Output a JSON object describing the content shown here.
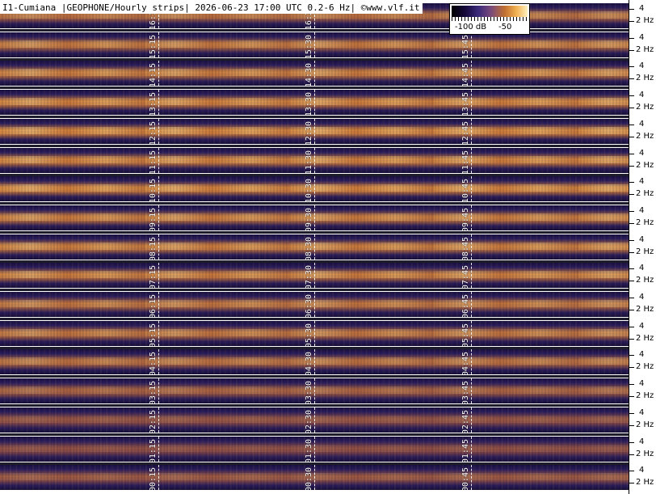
{
  "header": {
    "title": "I1-Cumiana |GEOPHONE/Hourly strips| 2026-06-23 17:00 UTC 0.2-6 Hz| ©www.vlf.it"
  },
  "colorbar": {
    "labels": [
      "-100 dB",
      "-50"
    ],
    "colors": [
      "#000000",
      "#14083a",
      "#3a2a7a",
      "#7a4a7a",
      "#c07030",
      "#f0b050",
      "#fff0c0"
    ]
  },
  "axis": {
    "upper_label": "4",
    "lower_label": "2 Hz"
  },
  "strips": [
    {
      "marks": [
        "16:15",
        "16:30",
        "16:45"
      ],
      "intensity": 0.55
    },
    {
      "marks": [
        "15:15",
        "15:30",
        "15:45"
      ],
      "intensity": 0.65
    },
    {
      "marks": [
        "14:15",
        "14:30",
        "14:45"
      ],
      "intensity": 0.7
    },
    {
      "marks": [
        "13:15",
        "13:30",
        "13:45"
      ],
      "intensity": 0.75
    },
    {
      "marks": [
        "12:15",
        "12:30",
        "12:45"
      ],
      "intensity": 0.8
    },
    {
      "marks": [
        "11:15",
        "11:30",
        "11:45"
      ],
      "intensity": 0.75
    },
    {
      "marks": [
        "10:15",
        "10:30",
        "10:45"
      ],
      "intensity": 0.8
    },
    {
      "marks": [
        "09:15",
        "09:30",
        "09:45"
      ],
      "intensity": 0.7
    },
    {
      "marks": [
        "08:15",
        "08:30",
        "08:45"
      ],
      "intensity": 0.72
    },
    {
      "marks": [
        "07:15",
        "07:30",
        "07:45"
      ],
      "intensity": 0.7
    },
    {
      "marks": [
        "06:15",
        "06:30",
        "06:45"
      ],
      "intensity": 0.6
    },
    {
      "marks": [
        "05:15",
        "05:30",
        "05:45"
      ],
      "intensity": 0.6
    },
    {
      "marks": [
        "04:15",
        "04:30",
        "04:45"
      ],
      "intensity": 0.55
    },
    {
      "marks": [
        "03:15",
        "03:30",
        "03:45"
      ],
      "intensity": 0.4
    },
    {
      "marks": [
        "02:15",
        "02:30",
        "02:45"
      ],
      "intensity": 0.25
    },
    {
      "marks": [
        "01:15",
        "01:30",
        "01:45"
      ],
      "intensity": 0.2
    },
    {
      "marks": [
        "00:15",
        "00:30",
        "00:45"
      ],
      "intensity": 0.3
    }
  ]
}
